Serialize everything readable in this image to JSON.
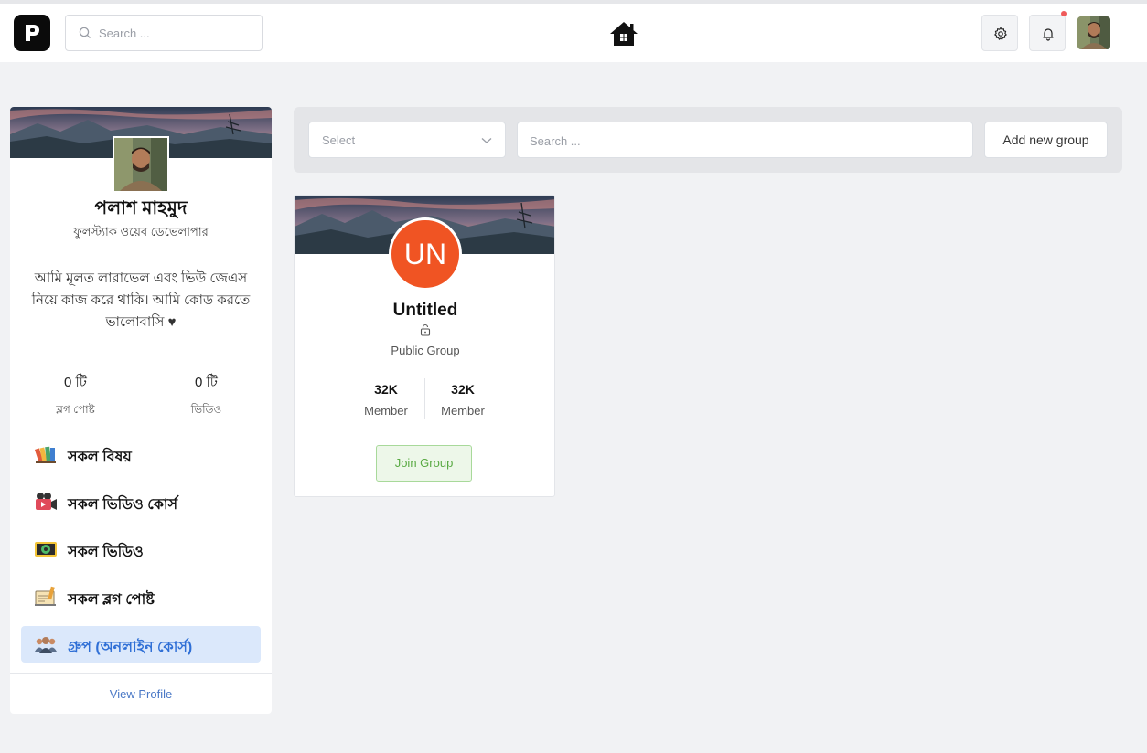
{
  "header": {
    "logo_letter": "P",
    "search_placeholder": "Search ...",
    "home_icon": "home-icon",
    "settings_icon": "gear-icon",
    "notifications_icon": "bell-icon",
    "has_notification": true,
    "notification_color": "#ef5a5a"
  },
  "profile": {
    "name": "পলাশ মাহমুদ",
    "role": "ফুলস্ট্যাক ওয়েব ডেভেলাপার",
    "bio": "আমি মূলত লারাভেল এবং ভিউ জেএস নিয়ে কাজ করে থাকি। আমি কোড করতে ভালোবাসি ♥",
    "stats": [
      {
        "value": "0 টি",
        "label": "ব্লগ পোষ্ট"
      },
      {
        "value": "0 টি",
        "label": "ভিডিও"
      }
    ],
    "menu": [
      {
        "label": "সকল বিষয়",
        "icon": "books-icon",
        "active": false
      },
      {
        "label": "সকল ভিডিও কোর্স",
        "icon": "video-camera-icon",
        "active": false
      },
      {
        "label": "সকল ভিডিও",
        "icon": "film-icon",
        "active": false
      },
      {
        "label": "সকল ব্লগ পোষ্ট",
        "icon": "writing-icon",
        "active": false
      },
      {
        "label": "গ্রুপ (অনলাইন কোর্স)",
        "icon": "group-icon",
        "active": true
      }
    ],
    "view_profile": "View Profile"
  },
  "filters": {
    "select_value": "Select",
    "search_placeholder": "Search ...",
    "add_button": "Add new group"
  },
  "groups": [
    {
      "initials": "UN",
      "avatar_color": "#f05423",
      "title": "Untitled",
      "lock_icon": "unlock-icon",
      "type": "Public Group",
      "stats": [
        {
          "value": "32K",
          "label": "Member"
        },
        {
          "value": "32K",
          "label": "Member"
        }
      ],
      "join_label": "Join Group"
    }
  ],
  "colors": {
    "accent": "#2f6fd6",
    "active_bg": "#dbe8fb",
    "join_green": "#5aaa44",
    "page_bg": "#f1f2f4"
  }
}
